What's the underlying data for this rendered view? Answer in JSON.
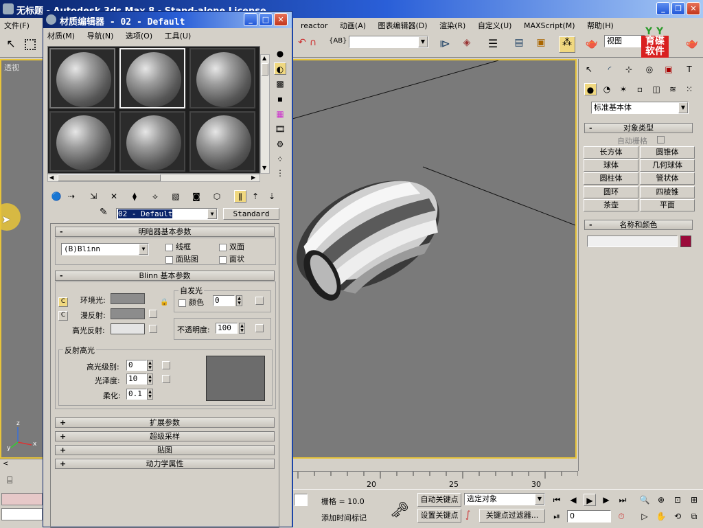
{
  "main_window": {
    "title": "无标题 - Autodesk 3ds Max 8 - Stand-alone License",
    "menu_left": "文件(F)",
    "menu_right": [
      "reactor",
      "动画(A)",
      "图表编辑器(D)",
      "渲染(R)",
      "自定义(U)",
      "MAXScript(M)",
      "帮助(H)"
    ],
    "toolbar_dropdown_value": "",
    "view_dropdown": "视图",
    "brand_logo_text": "育碟软件"
  },
  "viewport": {
    "label": "透视",
    "axes": {
      "x": "x",
      "y": "y",
      "z": "z"
    }
  },
  "material_editor": {
    "title": "材质编辑器 - 02 - Default",
    "menu": [
      "材质(M)",
      "导航(N)",
      "选项(O)",
      "工具(U)"
    ],
    "material_name": "02 - Default",
    "material_type": "Standard",
    "shader_rollout": {
      "header": "明暗器基本参数",
      "shader_value": "(B)Blinn",
      "wire": "线框",
      "two_sided": "双面",
      "face_map": "面贴图",
      "faceted": "面状"
    },
    "blinn_rollout": {
      "header": "Blinn 基本参数",
      "ambient": "环境光:",
      "diffuse": "漫反射:",
      "specular": "高光反射:",
      "self_illum_group": "自发光",
      "color_label": "颜色",
      "color_value": "0",
      "opacity_label": "不透明度:",
      "opacity_value": "100",
      "spec_group": "反射高光",
      "spec_level_label": "高光级别:",
      "spec_level_value": "0",
      "gloss_label": "光泽度:",
      "gloss_value": "10",
      "soften_label": "柔化:",
      "soften_value": "0.1"
    },
    "collapsed_rollouts": [
      "扩展参数",
      "超级采样",
      "贴图",
      "动力学属性"
    ]
  },
  "command_panel": {
    "category_dropdown": "标准基本体",
    "object_type_header": "对象类型",
    "autogrid": "自动栅格",
    "buttons": [
      "长方体",
      "圆锥体",
      "球体",
      "几何球体",
      "圆柱体",
      "管状体",
      "圆环",
      "四棱锥",
      "茶壶",
      "平面"
    ],
    "name_color_header": "名称和颜色",
    "object_color": "#9b0a3a"
  },
  "timeline": {
    "ticks": [
      "20",
      "25",
      "30"
    ]
  },
  "status_bar": {
    "grid": "栅格 = 10.0",
    "add_time_tag": "添加时间标记",
    "auto_key": "自动关键点",
    "set_key": "设置关键点",
    "selection_dropdown": "选定对象",
    "key_filters": "关键点过滤器...",
    "frame_value": "0"
  },
  "colors": {
    "viewport_bg": "#7a7a7a",
    "viewport_border": "#e8c43a",
    "title_blue": "#0a246a"
  }
}
